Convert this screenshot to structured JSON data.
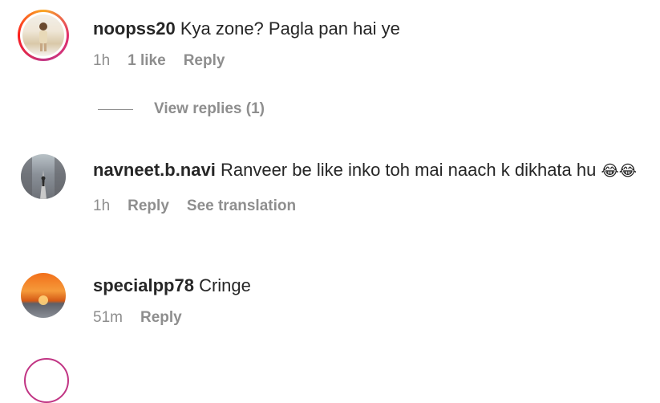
{
  "comments": [
    {
      "username": "noopss20",
      "text": "Kya zone? Pagla pan hai ye",
      "time": "1h",
      "likes": "1 like",
      "reply": "Reply"
    },
    {
      "username": "navneet.b.navi",
      "text": "Ranveer be like inko toh mai naach k dikhata hu",
      "emoji": "😂😂",
      "time": "1h",
      "reply": "Reply",
      "translate": "See translation"
    },
    {
      "username": "specialpp78",
      "text": "Cringe",
      "time": "51m",
      "reply": "Reply"
    }
  ],
  "view_replies": "View replies (1)"
}
